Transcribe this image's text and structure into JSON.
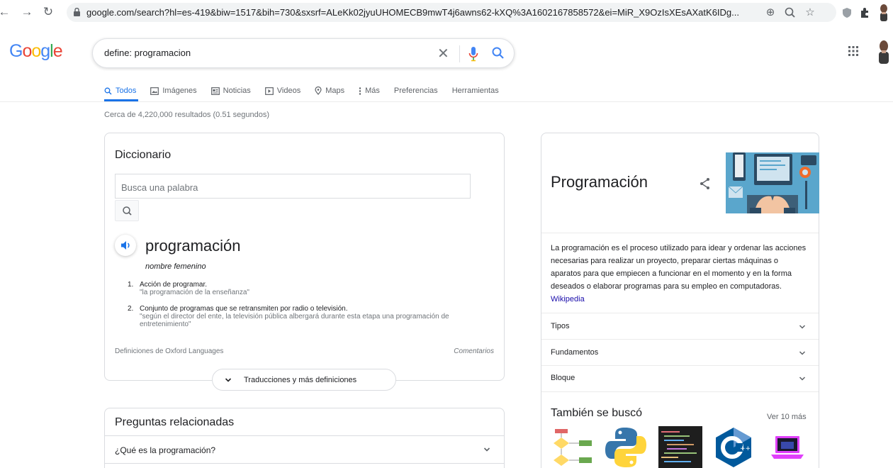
{
  "browser": {
    "url": "google.com/search?hl=es-419&biw=1517&bih=730&sxsrf=ALeKk02jyuUHOMECB9mwT4j6awns62-kXQ%3A1602167858572&ei=MiR_X9OzIsXEsAXatK6IDg..."
  },
  "header": {
    "logo": [
      "G",
      "o",
      "o",
      "g",
      "l",
      "e"
    ],
    "query": "define: programacion",
    "tabs": [
      "Todos",
      "Imágenes",
      "Noticias",
      "Videos",
      "Maps",
      "Más",
      "Preferencias",
      "Herramientas"
    ]
  },
  "results_count": "Cerca de 4,220,000 resultados (0.51 segundos)",
  "dictionary": {
    "title": "Diccionario",
    "search_placeholder": "Busca una palabra",
    "word": "programación",
    "part_of_speech": "nombre femenino",
    "definitions": [
      {
        "num": "1.",
        "text": "Acción de programar.",
        "example": "\"la programación de la enseñanza\""
      },
      {
        "num": "2.",
        "text": "Conjunto de programas que se retransmiten por radio o televisión.",
        "example": "\"según el director del ente, la televisión pública albergará durante esta etapa una programación de entretenimiento\""
      }
    ],
    "source": "Definiciones de Oxford Languages",
    "comments": "Comentarios",
    "more_button": "Traducciones y más definiciones"
  },
  "related": {
    "title": "Preguntas relacionadas",
    "questions": [
      "¿Qué es la programación?"
    ]
  },
  "knowledge_panel": {
    "title": "Programación",
    "description": "La programación es el proceso utilizado para idear y ordenar las acciones necesarias para realizar un proyecto, preparar ciertas máquinas o aparatos para que empiecen a funcionar en el momento y en la forma deseados o elaborar programas para su empleo en computadoras.",
    "source_link": "Wikipedia",
    "rows": [
      "Tipos",
      "Fundamentos",
      "Bloque"
    ],
    "also_searched": "También se buscó",
    "see_more": "Ver 10 más"
  },
  "colors": {
    "accent": "#1a73e8",
    "link": "#1a0dab"
  }
}
